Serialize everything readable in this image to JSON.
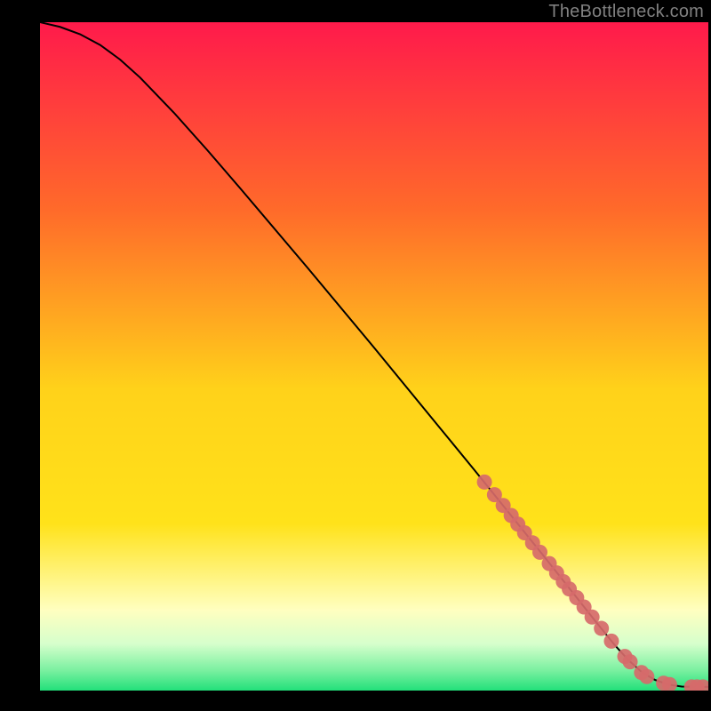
{
  "attribution": "TheBottleneck.com",
  "colors": {
    "bg": "#000000",
    "curve": "#000000",
    "marker_fill": "#d66a6a",
    "marker_stroke": "#d66a6a",
    "grad_top": "#ff1a4b",
    "grad_mid_upper": "#ff8a2a",
    "grad_mid": "#ffe21a",
    "grad_yellow_pale": "#ffff66",
    "grad_bottom_pale": "#d6ffcc",
    "grad_bottom": "#22e07a"
  },
  "chart_data": {
    "type": "line",
    "title": "",
    "xlabel": "",
    "ylabel": "",
    "xlim": [
      0,
      100
    ],
    "ylim": [
      0,
      100
    ],
    "curve": {
      "x": [
        0,
        3,
        6,
        9,
        12,
        15,
        20,
        25,
        30,
        35,
        40,
        45,
        50,
        55,
        60,
        65,
        70,
        75,
        80,
        83,
        86,
        88,
        90,
        92,
        94,
        96,
        98,
        100
      ],
      "y": [
        100,
        99.3,
        98.2,
        96.6,
        94.4,
        91.7,
        86.5,
        80.9,
        75.1,
        69.2,
        63.3,
        57.3,
        51.3,
        45.2,
        39.1,
        33.0,
        26.8,
        20.6,
        14.3,
        10.5,
        6.8,
        4.6,
        2.8,
        1.6,
        0.9,
        0.6,
        0.55,
        0.55
      ]
    },
    "series": [
      {
        "name": "points",
        "x": [
          66.5,
          68.0,
          69.3,
          70.5,
          71.5,
          72.5,
          73.7,
          74.8,
          76.2,
          77.3,
          78.3,
          79.2,
          80.3,
          81.4,
          82.6,
          84.0,
          85.5,
          87.5,
          88.3,
          90.0,
          90.8,
          93.3,
          94.2,
          97.5,
          98.3,
          99.2
        ],
        "y": [
          31.2,
          29.3,
          27.7,
          26.2,
          24.9,
          23.6,
          22.1,
          20.7,
          19.0,
          17.6,
          16.3,
          15.2,
          13.9,
          12.5,
          11.0,
          9.3,
          7.4,
          5.1,
          4.3,
          2.7,
          2.1,
          1.1,
          0.9,
          0.55,
          0.55,
          0.55
        ]
      }
    ]
  }
}
